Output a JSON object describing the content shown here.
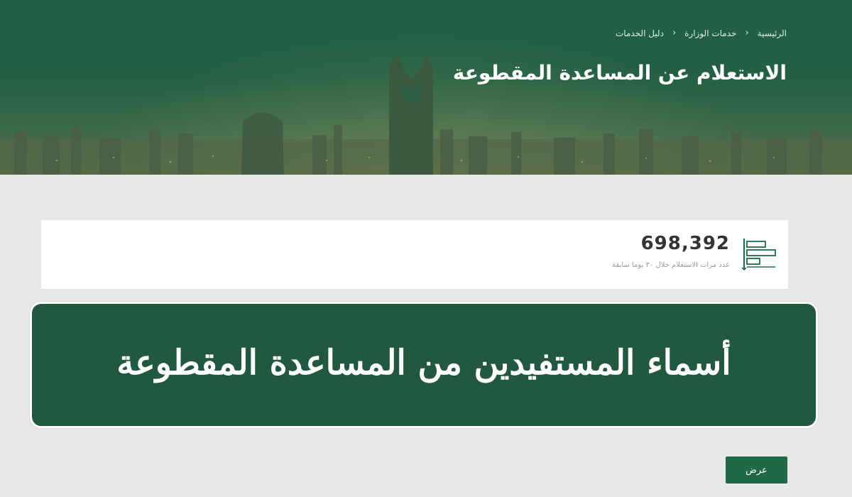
{
  "breadcrumb": {
    "items": [
      "الرئيسية",
      "خدمات الوزارة",
      "دليل الخدمات"
    ]
  },
  "page_title": "الاستعلام عن المساعدة المقطوعة",
  "stats": {
    "value": "698,392",
    "caption": "عدد مرات الاستعلام خلال ٣٠ يوما سابقة",
    "icon": "bar-chart-icon"
  },
  "overlay_banner": {
    "text": "أسماء المستفيدين من المساعدة المقطوعة"
  },
  "show_button": {
    "label": "عرض"
  },
  "colors": {
    "brand_green": "#1d6a45",
    "banner_green": "#235840",
    "hero_green": "#1f6046",
    "page_background": "#e6e8ea"
  }
}
